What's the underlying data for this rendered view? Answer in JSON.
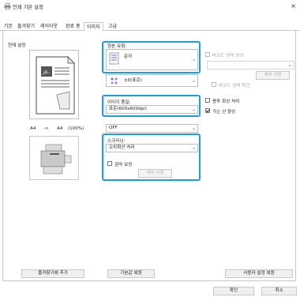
{
  "window": {
    "title": "인쇄 기본 설정",
    "close_glyph": "×"
  },
  "tabs": [
    {
      "label": "기본"
    },
    {
      "label": "즐겨찾기"
    },
    {
      "label": "레이아웃"
    },
    {
      "label": "완료 중"
    },
    {
      "label": "이미지",
      "active": true
    },
    {
      "label": "고급"
    }
  ],
  "left": {
    "current_settings_label": "현재 설정",
    "paper_from": "A4",
    "arrow": "->",
    "paper_to": "A4",
    "zoom": "(100%)"
  },
  "original_type": {
    "label": "원본 유형:",
    "value": "문자",
    "icon": "document-text-icon"
  },
  "color_mode": {
    "label": "",
    "value": "±0(표준)",
    "icon": "color-dots-icon"
  },
  "image_quality": {
    "label": "이미지 품질:",
    "value": "표준(600x600dpi)"
  },
  "third_select": {
    "value": "OFF"
  },
  "screening": {
    "label": "스크리닝:",
    "value": "오차확산 처리",
    "gamma_label": "감마 보정",
    "detail_button": "세부 사항"
  },
  "barcode": {
    "area_label": "바코드 영역 정의",
    "detail_button": "세부 사항",
    "confirm_label": "바코드 영역 확인"
  },
  "options": {
    "toner_save_label": "용투 화상 처리",
    "thin_line_label": "가는 선 향상",
    "thin_line_checked": true
  },
  "bottom": {
    "add_favorite": "즐겨찾기에 추가",
    "restore_default": "기본값 복원",
    "restore_user": "사용자 설정 복원"
  },
  "footer": {
    "ok": "확인",
    "cancel": "취소"
  },
  "colors": {
    "highlight": "#1a9ee0",
    "border": "#c8c8c8"
  }
}
